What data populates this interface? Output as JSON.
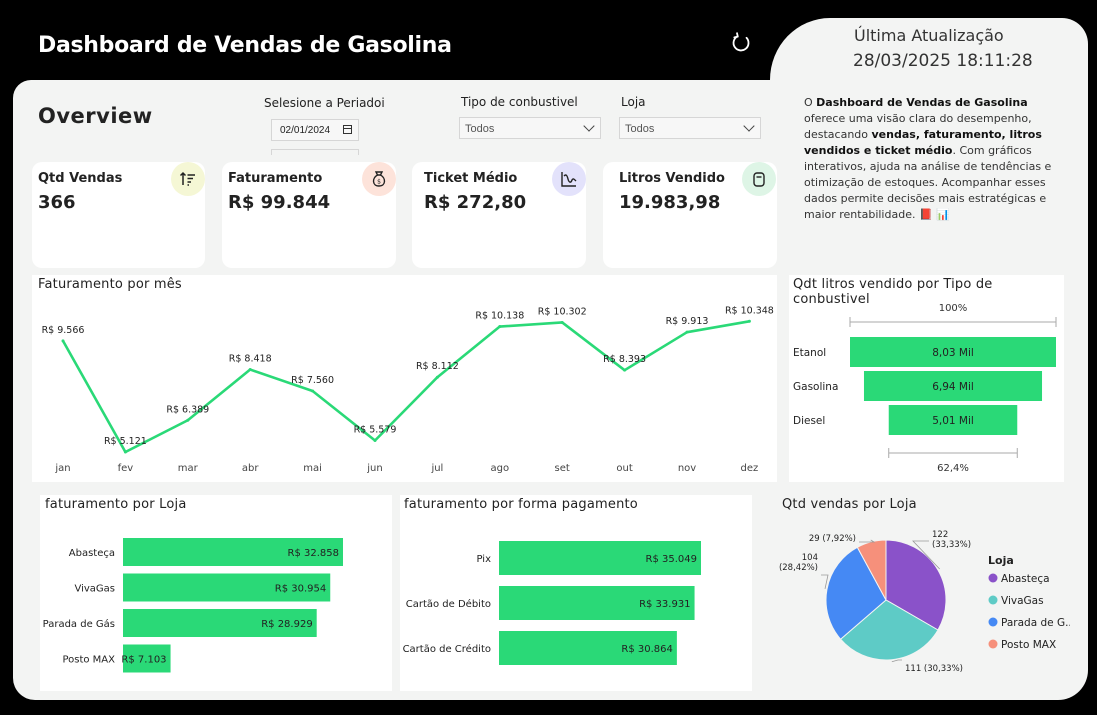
{
  "header": {
    "title": "Dashboard de Vendas de Gasolina",
    "last_update_label": "Última Atualização",
    "last_update_value": "28/03/2025 18:11:28",
    "refresh_icon": "refresh-icon"
  },
  "page": {
    "overview": "Overview"
  },
  "filters": {
    "period_label": "Selesione a Periadoi",
    "period_start": "02/01/2024",
    "fuel_label": "Tipo de conbustivel",
    "fuel_value": "Todos",
    "store_label": "Loja",
    "store_value": "Todos"
  },
  "description": {
    "part1": "O ",
    "bold1": "Dashboard de Vendas de Gasolina",
    "part2": " oferece uma visão clara do desempenho, destacando ",
    "bold2": "vendas, faturamento, litros vendidos e ticket médio",
    "part3": ". Com gráficos interativos, ajuda na análise de tendências e otimização de estoques. Acompanhar esses dados permite decisões mais estratégicas e maior rentabilidade. 📕 📊"
  },
  "kpis": [
    {
      "label": "Qtd Vendas",
      "value": "366",
      "icon": "sort-ascending-icon",
      "icon_bg": "#f5f7d5"
    },
    {
      "label": "Faturamento",
      "value": "R$ 99.844",
      "icon": "money-bag-icon",
      "icon_bg": "#fde3da"
    },
    {
      "label": "Ticket Médio",
      "value": "R$ 272,80",
      "icon": "wave-chart-icon",
      "icon_bg": "#e3e2fb"
    },
    {
      "label": "Litros Vendido",
      "value": "19.983,98",
      "icon": "fuel-can-icon",
      "icon_bg": "#def5e6"
    }
  ],
  "colors": {
    "accent_green": "#2ad977",
    "pie": [
      "#8a52c9",
      "#5ecbc6",
      "#4589f4",
      "#f6907b"
    ]
  },
  "chart_data": [
    {
      "type": "line",
      "title": "Faturamento por mês",
      "categories": [
        "jan",
        "fev",
        "mar",
        "abr",
        "mai",
        "jun",
        "jul",
        "ago",
        "set",
        "out",
        "nov",
        "dez"
      ],
      "values": [
        9566,
        5121,
        6389,
        8418,
        7560,
        5579,
        8112,
        10138,
        10302,
        8393,
        9913,
        10348
      ],
      "labels": [
        "R$ 9.566",
        "R$ 5.121",
        "R$ 6.389",
        "R$ 8.418",
        "R$ 7.560",
        "R$ 5.579",
        "R$ 8.112",
        "R$ 10.138",
        "R$ 10.302",
        "R$ 8.393",
        "R$ 9.913",
        "R$ 10.348"
      ],
      "ylim": [
        5000,
        10400
      ],
      "grid": false
    },
    {
      "type": "bar",
      "subtype": "funnel",
      "title": "Qdt litros vendido por Tipo de conbustivel",
      "categories": [
        "Etanol",
        "Gasolina",
        "Diesel"
      ],
      "values": [
        8030,
        6940,
        5010
      ],
      "labels": [
        "8,03 Mil",
        "6,94 Mil",
        "5,01 Mil"
      ],
      "top_label": "100%",
      "bottom_label": "62,4%"
    },
    {
      "type": "bar",
      "orientation": "horizontal",
      "title": "faturamento por Loja",
      "categories": [
        "Abasteça",
        "VivaGas",
        "Parada de Gás",
        "Posto MAX"
      ],
      "values": [
        32858,
        30954,
        28929,
        7103
      ],
      "labels": [
        "R$ 32.858",
        "R$ 30.954",
        "R$ 28.929",
        "R$ 7.103"
      ]
    },
    {
      "type": "bar",
      "orientation": "horizontal",
      "title": "faturamento por forma pagamento",
      "categories": [
        "Pix",
        "Cartão de Débito",
        "Cartão de Crédito"
      ],
      "values": [
        35049,
        33931,
        30864
      ],
      "labels": [
        "R$ 35.049",
        "R$ 33.931",
        "R$ 30.864"
      ]
    },
    {
      "type": "pie",
      "title": "Qtd vendas por Loja",
      "legend_title": "Loja",
      "legend_position": "right",
      "categories": [
        "Abasteça",
        "VivaGas",
        "Parada de Gás",
        "Posto MAX"
      ],
      "legend_labels": [
        "Abasteça",
        "VivaGas",
        "Parada de G...",
        "Posto MAX"
      ],
      "values": [
        122,
        111,
        104,
        29
      ],
      "data_labels": [
        [
          "122",
          "(33,33%)"
        ],
        [
          "111 (30,33%)"
        ],
        [
          "104",
          "(28,42%)"
        ],
        [
          "29 (7,92%)"
        ]
      ]
    }
  ]
}
